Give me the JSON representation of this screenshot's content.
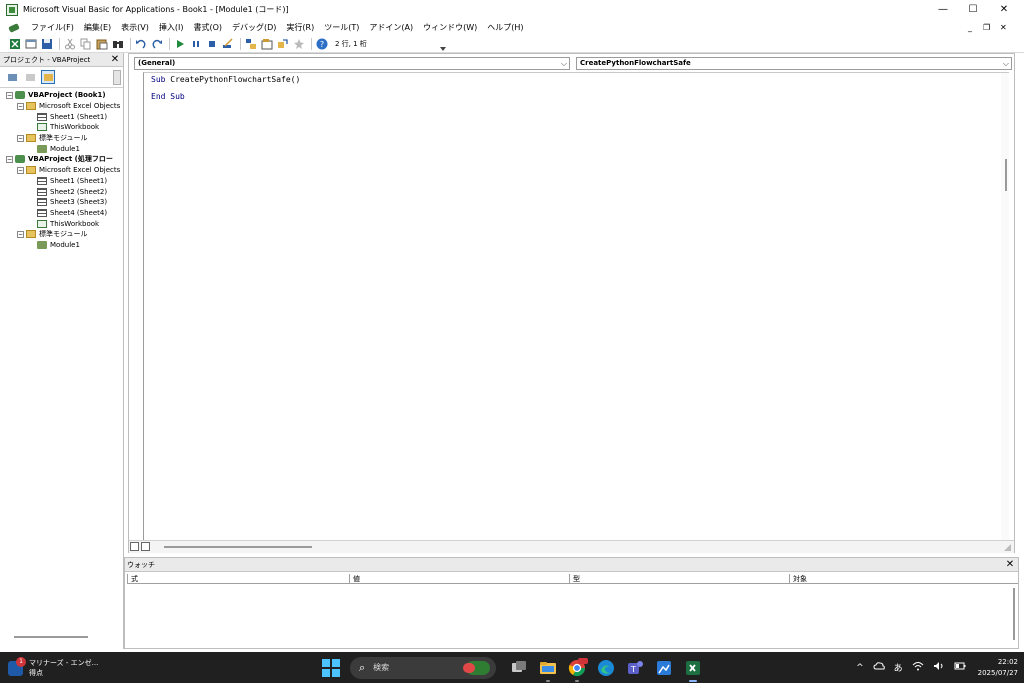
{
  "window": {
    "title": "Microsoft Visual Basic for Applications - Book1 - [Module1 (コード)]",
    "controls": {
      "minimize": "—",
      "maximize": "☐",
      "close": "✕"
    }
  },
  "menubar": {
    "items": [
      "ファイル(F)",
      "編集(E)",
      "表示(V)",
      "挿入(I)",
      "書式(O)",
      "デバッグ(D)",
      "実行(R)",
      "ツール(T)",
      "アドイン(A)",
      "ウィンドウ(W)",
      "ヘルプ(H)"
    ],
    "mdi_controls": {
      "minimize": "_",
      "restore": "❐",
      "close": "✕"
    }
  },
  "toolbar": {
    "position_text": "2 行, 1 桁"
  },
  "project_pane": {
    "title": "プロジェクト - VBAProject",
    "close": "✕",
    "tree": [
      {
        "level": 0,
        "toggle": "−",
        "icon": "project",
        "label": "VBAProject (Book1)",
        "bold": true
      },
      {
        "level": 1,
        "toggle": "−",
        "icon": "folder",
        "label": "Microsoft Excel Objects"
      },
      {
        "level": 2,
        "toggle": "",
        "icon": "sheet",
        "label": "Sheet1 (Sheet1)"
      },
      {
        "level": 2,
        "toggle": "",
        "icon": "wb",
        "label": "ThisWorkbook"
      },
      {
        "level": 1,
        "toggle": "−",
        "icon": "folder",
        "label": "標準モジュール"
      },
      {
        "level": 2,
        "toggle": "",
        "icon": "module",
        "label": "Module1"
      },
      {
        "level": 0,
        "toggle": "−",
        "icon": "project",
        "label": "VBAProject (処理フロー",
        "bold": true
      },
      {
        "level": 1,
        "toggle": "−",
        "icon": "folder",
        "label": "Microsoft Excel Objects"
      },
      {
        "level": 2,
        "toggle": "",
        "icon": "sheet",
        "label": "Sheet1 (Sheet1)"
      },
      {
        "level": 2,
        "toggle": "",
        "icon": "sheet",
        "label": "Sheet2 (Sheet2)"
      },
      {
        "level": 2,
        "toggle": "",
        "icon": "sheet",
        "label": "Sheet3 (Sheet3)"
      },
      {
        "level": 2,
        "toggle": "",
        "icon": "sheet",
        "label": "Sheet4 (Sheet4)"
      },
      {
        "level": 2,
        "toggle": "",
        "icon": "wb",
        "label": "ThisWorkbook"
      },
      {
        "level": 1,
        "toggle": "−",
        "icon": "folder",
        "label": "標準モジュール"
      },
      {
        "level": 2,
        "toggle": "",
        "icon": "module",
        "label": "Module1"
      }
    ]
  },
  "code_window": {
    "object_combo": "(General)",
    "procedure_combo": "CreatePythonFlowchartSafe",
    "lines": [
      {
        "kw": "Sub",
        "rest": " CreatePythonFlowchartSafe()"
      },
      {
        "kw": "End Sub",
        "rest": ""
      }
    ]
  },
  "watch_window": {
    "title": "ウォッチ",
    "close": "✕",
    "columns": [
      "式",
      "値",
      "型",
      "対象"
    ]
  },
  "taskbar": {
    "widget": {
      "badge": "1",
      "line1": "マリナーズ - エンゼ...",
      "line2": "得点"
    },
    "search_placeholder": "検索",
    "tray": {
      "chevron": "^",
      "ime": "あ"
    },
    "clock": {
      "time": "22:02",
      "date": "2025/07/27"
    }
  },
  "colors": {
    "keyword": "#00007f",
    "taskbar": "#202020",
    "accent": "#4cc2ff"
  }
}
